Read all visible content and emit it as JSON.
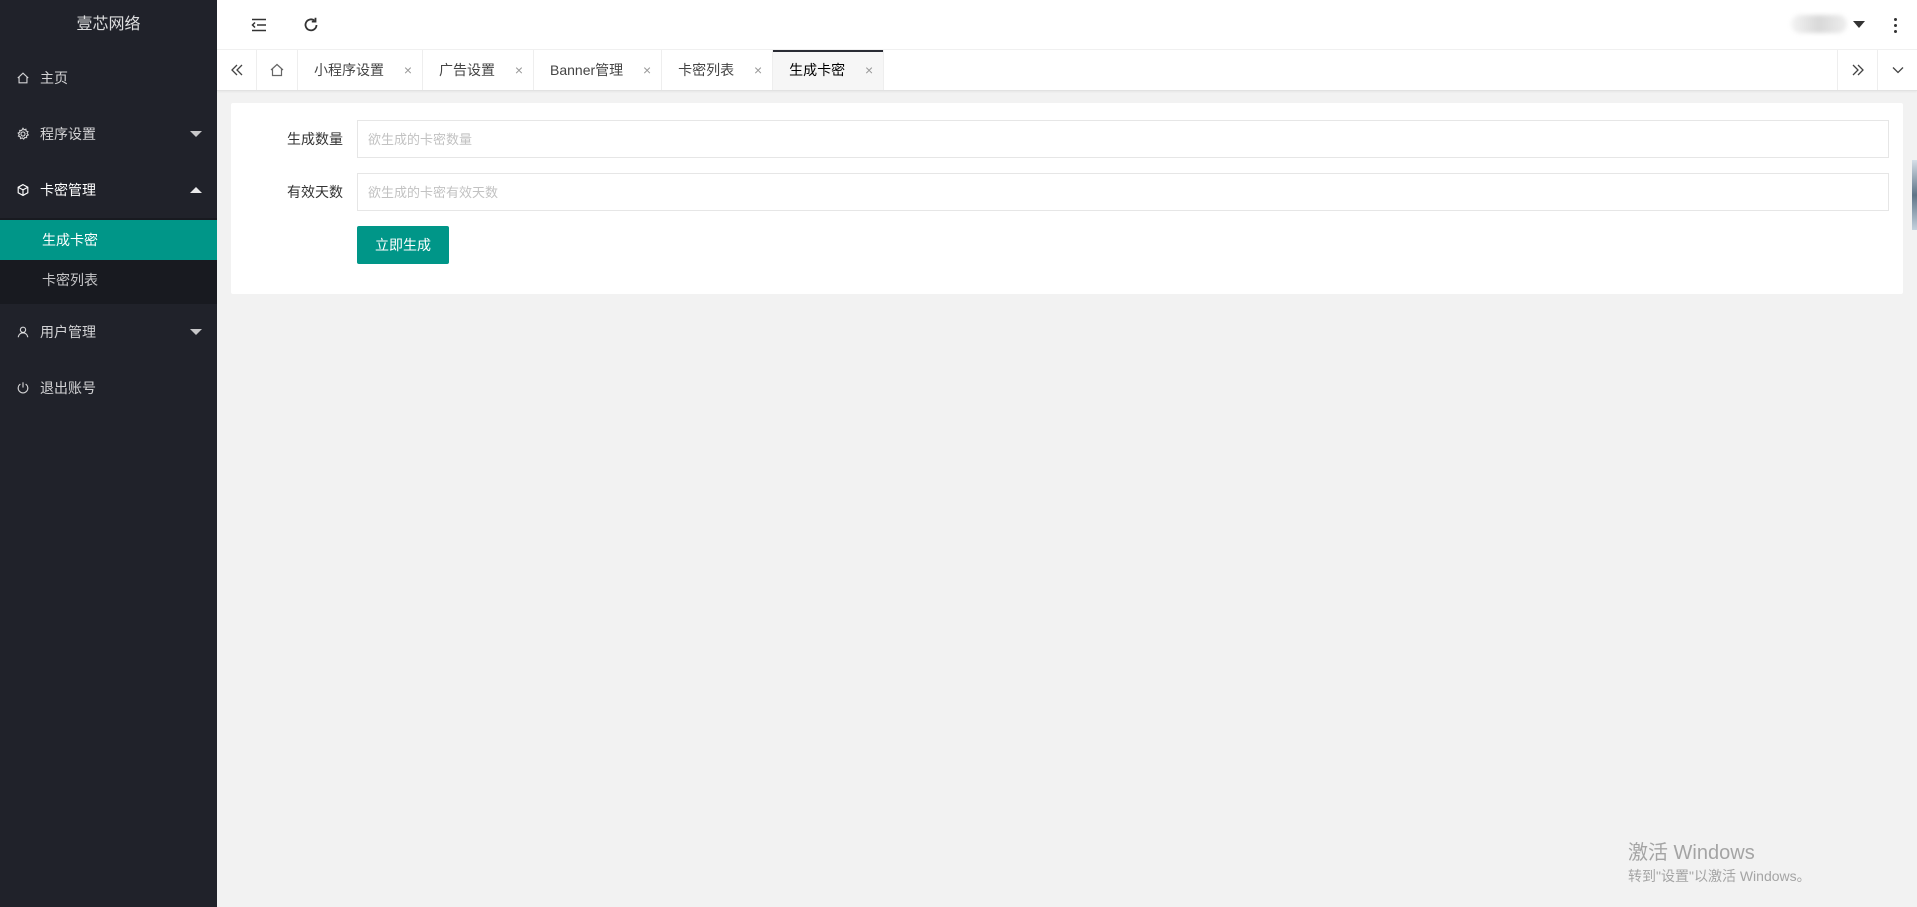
{
  "sidebar": {
    "logo": "壹芯网络",
    "items": [
      {
        "label": "主页",
        "icon": "home-icon"
      },
      {
        "label": "程序设置",
        "icon": "gear-icon",
        "expanded": false
      },
      {
        "label": "卡密管理",
        "icon": "cube-icon",
        "expanded": true,
        "children": [
          {
            "label": "生成卡密",
            "active": true
          },
          {
            "label": "卡密列表",
            "active": false
          }
        ]
      },
      {
        "label": "用户管理",
        "icon": "user-icon",
        "expanded": false
      },
      {
        "label": "退出账号",
        "icon": "power-icon"
      }
    ]
  },
  "header": {
    "menu_toggle_icon": "menu-fold-icon",
    "refresh_icon": "refresh-icon",
    "more_icon": "more-vertical-icon"
  },
  "tabs": {
    "items": [
      {
        "label": "小程序设置",
        "close": "×"
      },
      {
        "label": "广告设置",
        "close": "×"
      },
      {
        "label": "Banner管理",
        "close": "×"
      },
      {
        "label": "卡密列表",
        "close": "×"
      },
      {
        "label": "生成卡密",
        "close": "×",
        "active": true
      }
    ]
  },
  "form": {
    "count_label": "生成数量",
    "count_placeholder": "欲生成的卡密数量",
    "count_value": "",
    "days_label": "有效天数",
    "days_placeholder": "欲生成的卡密有效天数",
    "days_value": "",
    "submit_label": "立即生成"
  },
  "watermark": {
    "title": "激活 Windows",
    "subtitle": "转到\"设置\"以激活 Windows。"
  },
  "colors": {
    "sidebar_bg": "#20222a",
    "active_green": "#009688",
    "page_bg": "#f2f2f2"
  }
}
